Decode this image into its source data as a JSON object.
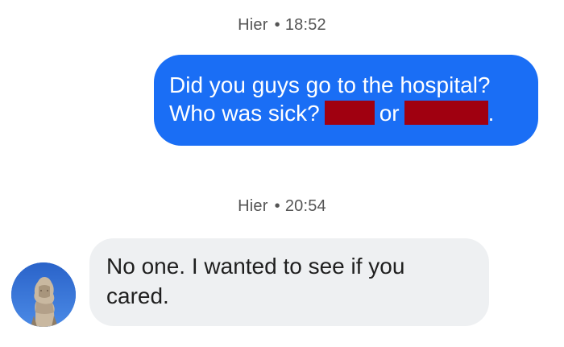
{
  "messages": [
    {
      "timestamp": {
        "day": "Hier",
        "time": "18:52"
      },
      "direction": "outgoing",
      "line1": "Did you guys go to the hospital?",
      "line2_a": "Who was sick?",
      "line2_b": "or",
      "line2_c": "."
    },
    {
      "timestamp": {
        "day": "Hier",
        "time": "20:54"
      },
      "direction": "incoming",
      "line1": "No one. I wanted to see if you",
      "line2": "cared."
    }
  ],
  "separator_glyph": "•",
  "colors": {
    "outgoing_bubble": "#1a6ef5",
    "incoming_bubble": "#eef0f2",
    "redaction": "#a00010",
    "background": "#ffffff"
  },
  "avatar": {
    "icon": "statue-avatar-icon"
  }
}
